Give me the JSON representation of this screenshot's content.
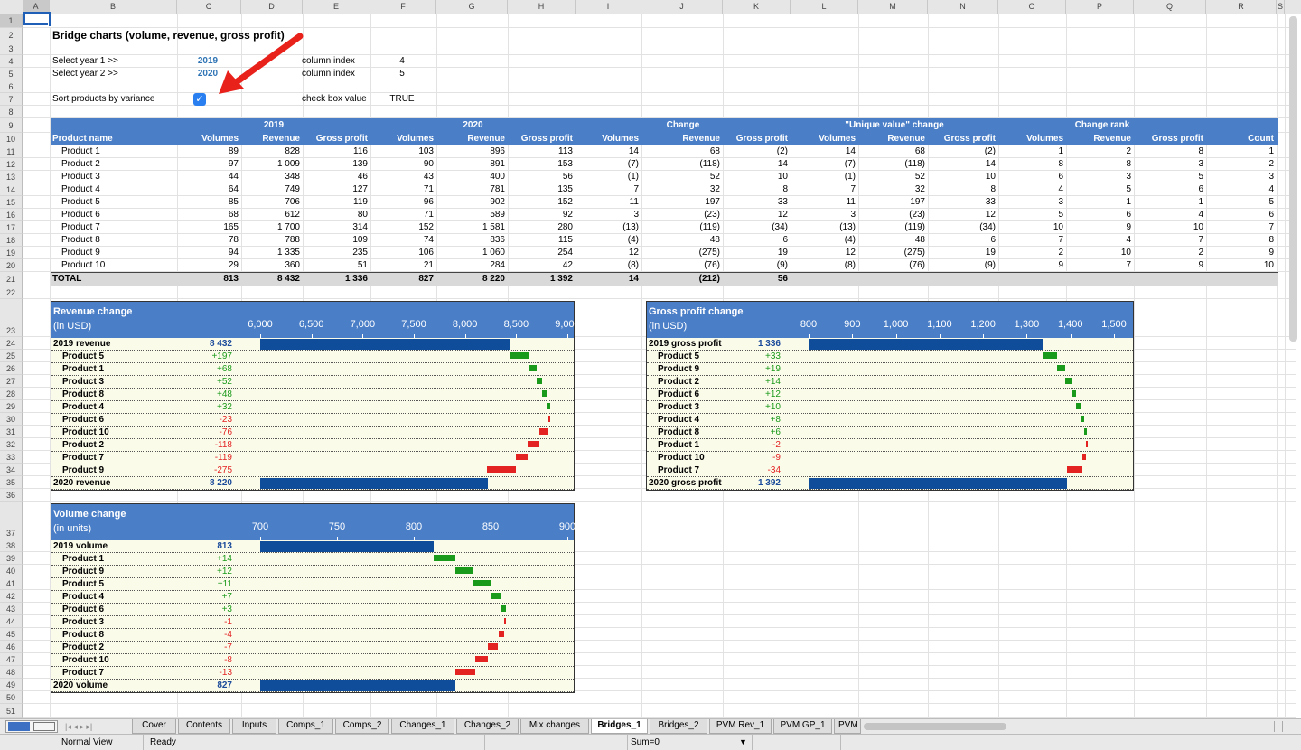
{
  "columns": [
    "A",
    "B",
    "C",
    "D",
    "E",
    "F",
    "G",
    "H",
    "I",
    "J",
    "K",
    "L",
    "M",
    "N",
    "O",
    "P",
    "Q",
    "R",
    "S"
  ],
  "rows": [
    "1",
    "2",
    "3",
    "4",
    "5",
    "6",
    "7",
    "8",
    "9",
    "10",
    "11",
    "12",
    "13",
    "14",
    "15",
    "16",
    "17",
    "18",
    "19",
    "20",
    "21",
    "22",
    "23",
    "24",
    "25",
    "26",
    "27",
    "28",
    "29",
    "30",
    "31",
    "32",
    "33",
    "34",
    "35",
    "36",
    "37",
    "38",
    "39",
    "40",
    "41",
    "42",
    "43",
    "44",
    "45",
    "46",
    "47",
    "48",
    "49",
    "50",
    "51"
  ],
  "title": "Bridge charts (volume, revenue, gross profit)",
  "controls": {
    "year1_label": "Select year 1 >>",
    "year1": "2019",
    "year2_label": "Select year 2 >>",
    "year2": "2020",
    "col_index_label": "column index",
    "col_index1": "4",
    "col_index2": "5",
    "sort_label": "Sort products by variance",
    "checkbox_label": "check box value",
    "checkbox_value": "TRUE",
    "checkbox_mark": "✓"
  },
  "table": {
    "groups": [
      "2019",
      "2020",
      "Change",
      "\"Unique value\" change",
      "Change rank"
    ],
    "first_header": "Product name",
    "subheaders": [
      "Volumes",
      "Revenue",
      "Gross profit",
      "Volumes",
      "Revenue",
      "Gross profit",
      "Volumes",
      "Revenue",
      "Gross profit",
      "Volumes",
      "Revenue",
      "Gross profit",
      "Volumes",
      "Revenue",
      "Gross profit",
      "Count"
    ],
    "rows": [
      [
        "Product 1",
        "89",
        "828",
        "116",
        "103",
        "896",
        "113",
        "14",
        "68",
        "(2)",
        "14",
        "68",
        "(2)",
        "1",
        "2",
        "8",
        "1"
      ],
      [
        "Product 2",
        "97",
        "1 009",
        "139",
        "90",
        "891",
        "153",
        "(7)",
        "(118)",
        "14",
        "(7)",
        "(118)",
        "14",
        "8",
        "8",
        "3",
        "2"
      ],
      [
        "Product 3",
        "44",
        "348",
        "46",
        "43",
        "400",
        "56",
        "(1)",
        "52",
        "10",
        "(1)",
        "52",
        "10",
        "6",
        "3",
        "5",
        "3"
      ],
      [
        "Product 4",
        "64",
        "749",
        "127",
        "71",
        "781",
        "135",
        "7",
        "32",
        "8",
        "7",
        "32",
        "8",
        "4",
        "5",
        "6",
        "4"
      ],
      [
        "Product 5",
        "85",
        "706",
        "119",
        "96",
        "902",
        "152",
        "11",
        "197",
        "33",
        "11",
        "197",
        "33",
        "3",
        "1",
        "1",
        "5"
      ],
      [
        "Product 6",
        "68",
        "612",
        "80",
        "71",
        "589",
        "92",
        "3",
        "(23)",
        "12",
        "3",
        "(23)",
        "12",
        "5",
        "6",
        "4",
        "6"
      ],
      [
        "Product 7",
        "165",
        "1 700",
        "314",
        "152",
        "1 581",
        "280",
        "(13)",
        "(119)",
        "(34)",
        "(13)",
        "(119)",
        "(34)",
        "10",
        "9",
        "10",
        "7"
      ],
      [
        "Product 8",
        "78",
        "788",
        "109",
        "74",
        "836",
        "115",
        "(4)",
        "48",
        "6",
        "(4)",
        "48",
        "6",
        "7",
        "4",
        "7",
        "8"
      ],
      [
        "Product 9",
        "94",
        "1 335",
        "235",
        "106",
        "1 060",
        "254",
        "12",
        "(275)",
        "19",
        "12",
        "(275)",
        "19",
        "2",
        "10",
        "2",
        "9"
      ],
      [
        "Product 10",
        "29",
        "360",
        "51",
        "21",
        "284",
        "42",
        "(8)",
        "(76)",
        "(9)",
        "(8)",
        "(76)",
        "(9)",
        "9",
        "7",
        "9",
        "10"
      ]
    ],
    "total": [
      "TOTAL",
      "813",
      "8 432",
      "1 336",
      "827",
      "8 220",
      "1 392",
      "14",
      "(212)",
      "56"
    ]
  },
  "charts": [
    {
      "title": "Revenue change",
      "subtitle": "(in USD)",
      "ticks": [
        "6,000",
        "6,500",
        "7,000",
        "7,500",
        "8,000",
        "8,500",
        "9,000"
      ],
      "ticks_values": [
        6000,
        6500,
        7000,
        7500,
        8000,
        8500,
        9000
      ],
      "start_label": "2019 revenue",
      "start_value": "8 432",
      "start": 8432,
      "items": [
        [
          "Product 5",
          "+197",
          197
        ],
        [
          "Product 1",
          "+68",
          68
        ],
        [
          "Product 3",
          "+52",
          52
        ],
        [
          "Product 8",
          "+48",
          48
        ],
        [
          "Product 4",
          "+32",
          32
        ],
        [
          "Product 6",
          "-23",
          -23
        ],
        [
          "Product 10",
          "-76",
          -76
        ],
        [
          "Product 2",
          "-118",
          -118
        ],
        [
          "Product 7",
          "-119",
          -119
        ],
        [
          "Product 9",
          "-275",
          -275
        ]
      ],
      "end_label": "2020 revenue",
      "end_value": "8 220",
      "end": 8220
    },
    {
      "title": "Gross profit change",
      "subtitle": "(in USD)",
      "ticks": [
        "800",
        "900",
        "1,000",
        "1,100",
        "1,200",
        "1,300",
        "1,400",
        "1,500"
      ],
      "ticks_values": [
        800,
        900,
        1000,
        1100,
        1200,
        1300,
        1400,
        1500
      ],
      "start_label": "2019 gross profit",
      "start_value": "1 336",
      "start": 1336,
      "items": [
        [
          "Product 5",
          "+33",
          33
        ],
        [
          "Product 9",
          "+19",
          19
        ],
        [
          "Product 2",
          "+14",
          14
        ],
        [
          "Product 6",
          "+12",
          12
        ],
        [
          "Product 3",
          "+10",
          10
        ],
        [
          "Product 4",
          "+8",
          8
        ],
        [
          "Product 8",
          "+6",
          6
        ],
        [
          "Product 1",
          "-2",
          -2
        ],
        [
          "Product 10",
          "-9",
          -9
        ],
        [
          "Product 7",
          "-34",
          -34
        ]
      ],
      "end_label": "2020 gross profit",
      "end_value": "1 392",
      "end": 1392
    },
    {
      "title": "Volume change",
      "subtitle": "(in units)",
      "ticks": [
        "700",
        "750",
        "800",
        "850",
        "900"
      ],
      "ticks_values": [
        700,
        750,
        800,
        850,
        900
      ],
      "start_label": "2019 volume",
      "start_value": "813",
      "start": 813,
      "items": [
        [
          "Product 1",
          "+14",
          14
        ],
        [
          "Product 9",
          "+12",
          12
        ],
        [
          "Product 5",
          "+11",
          11
        ],
        [
          "Product 4",
          "+7",
          7
        ],
        [
          "Product 6",
          "+3",
          3
        ],
        [
          "Product 3",
          "-1",
          -1
        ],
        [
          "Product 8",
          "-4",
          -4
        ],
        [
          "Product 2",
          "-7",
          -7
        ],
        [
          "Product 10",
          "-8",
          -8
        ],
        [
          "Product 7",
          "-13",
          -13
        ]
      ],
      "end_label": "2020 volume",
      "end_value": "827",
      "end": 827
    }
  ],
  "tabs": [
    "Cover",
    "Contents",
    "Inputs",
    "Comps_1",
    "Comps_2",
    "Changes_1",
    "Changes_2",
    "Mix changes",
    "Bridges_1",
    "Bridges_2",
    "PVM Rev_1",
    "PVM GP_1",
    "PVM"
  ],
  "active_tab": "Bridges_1",
  "status": {
    "view": "Normal View",
    "state": "Ready",
    "sum": "Sum=0"
  },
  "colors": {
    "header_blue": "#4a7ec7",
    "bar_blue": "#0f4c9a",
    "positive": "#1a9a1a",
    "negative": "#e32222",
    "chart_bg": "#fbfbea"
  }
}
